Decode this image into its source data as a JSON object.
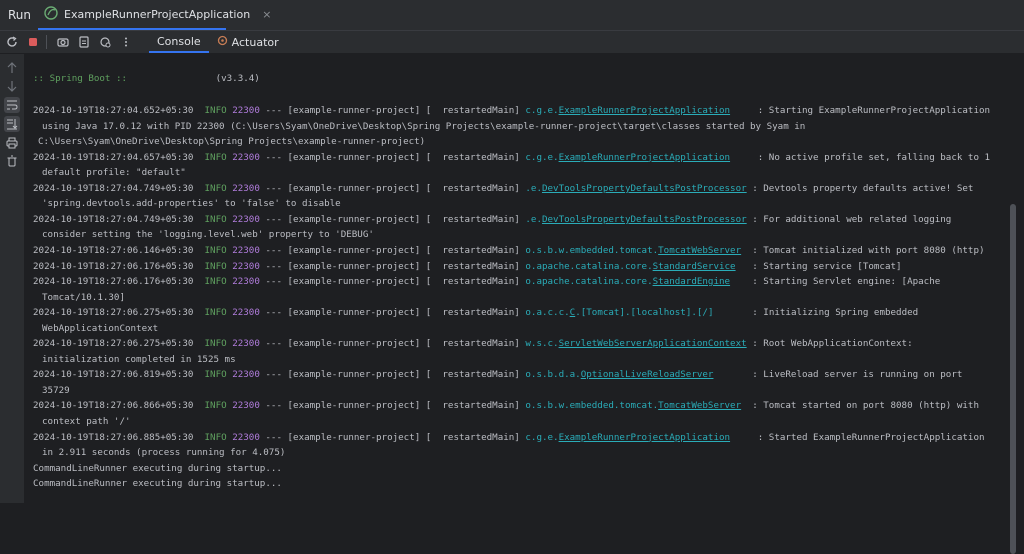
{
  "topbar": {
    "run_label": "Run",
    "tab_title": "ExampleRunnerProjectApplication",
    "tab_close": "×"
  },
  "toolbar": {
    "tabs": [
      {
        "label": "Console"
      },
      {
        "label": "Actuator"
      }
    ]
  },
  "console": {
    "boot_name": ":: Spring Boot ::",
    "boot_version": "(v3.3.4)",
    "logs": [
      {
        "ts": "2024-10-19T18:27:04.652+05:30",
        "level": "INFO",
        "pid": "22300",
        "mid": " --- [example-runner-project] [  restartedMain] ",
        "logger_prefix": "c.g.e.",
        "logger_link": "ExampleRunnerProjectApplication",
        "logger_suffix": "",
        "pad": "     ",
        "msg": ": Starting ExampleRunnerProjectApplication",
        "cont": [
          "using Java 17.0.12 with PID 22300 (C:\\Users\\Syam\\OneDrive\\Desktop\\Spring Projects\\example-runner-project\\target\\classes started by Syam in",
          "C:\\Users\\Syam\\OneDrive\\Desktop\\Spring Projects\\example-runner-project)"
        ]
      },
      {
        "ts": "2024-10-19T18:27:04.657+05:30",
        "level": "INFO",
        "pid": "22300",
        "mid": " --- [example-runner-project] [  restartedMain] ",
        "logger_prefix": "c.g.e.",
        "logger_link": "ExampleRunnerProjectApplication",
        "logger_suffix": "",
        "pad": "     ",
        "msg": ": No active profile set, falling back to 1",
        "cont": [
          "default profile: \"default\""
        ]
      },
      {
        "ts": "2024-10-19T18:27:04.749+05:30",
        "level": "INFO",
        "pid": "22300",
        "mid": " --- [example-runner-project] [  restartedMain] ",
        "logger_prefix": ".e.",
        "logger_link": "DevToolsPropertyDefaultsPostProcessor",
        "logger_suffix": "",
        "pad": " ",
        "msg": ": Devtools property defaults active! Set",
        "cont": [
          "'spring.devtools.add-properties' to 'false' to disable"
        ]
      },
      {
        "ts": "2024-10-19T18:27:04.749+05:30",
        "level": "INFO",
        "pid": "22300",
        "mid": " --- [example-runner-project] [  restartedMain] ",
        "logger_prefix": ".e.",
        "logger_link": "DevToolsPropertyDefaultsPostProcessor",
        "logger_suffix": "",
        "pad": " ",
        "msg": ": For additional web related logging",
        "cont": [
          "consider setting the 'logging.level.web' property to 'DEBUG'"
        ]
      },
      {
        "ts": "2024-10-19T18:27:06.146+05:30",
        "level": "INFO",
        "pid": "22300",
        "mid": " --- [example-runner-project] [  restartedMain] ",
        "logger_prefix": "o.s.b.w.embedded.tomcat.",
        "logger_link": "TomcatWebServer",
        "logger_suffix": "",
        "pad": "  ",
        "msg": ": Tomcat initialized with port 8080 (http)",
        "cont": []
      },
      {
        "ts": "2024-10-19T18:27:06.176+05:30",
        "level": "INFO",
        "pid": "22300",
        "mid": " --- [example-runner-project] [  restartedMain] ",
        "logger_prefix": "o.apache.catalina.core.",
        "logger_link": "StandardService",
        "logger_suffix": "",
        "pad": "   ",
        "msg": ": Starting service [Tomcat]",
        "cont": []
      },
      {
        "ts": "2024-10-19T18:27:06.176+05:30",
        "level": "INFO",
        "pid": "22300",
        "mid": " --- [example-runner-project] [  restartedMain] ",
        "logger_prefix": "o.apache.catalina.core.",
        "logger_link": "StandardEngine",
        "logger_suffix": "",
        "pad": "    ",
        "msg": ": Starting Servlet engine: [Apache",
        "cont": [
          "Tomcat/10.1.30]"
        ]
      },
      {
        "ts": "2024-10-19T18:27:06.275+05:30",
        "level": "INFO",
        "pid": "22300",
        "mid": " --- [example-runner-project] [  restartedMain] ",
        "logger_prefix": "o.a.c.c.",
        "logger_link": "C",
        "logger_suffix": ".[Tomcat].[localhost].[/]",
        "pad": "       ",
        "msg": ": Initializing Spring embedded",
        "cont": [
          "WebApplicationContext"
        ]
      },
      {
        "ts": "2024-10-19T18:27:06.275+05:30",
        "level": "INFO",
        "pid": "22300",
        "mid": " --- [example-runner-project] [  restartedMain] ",
        "logger_prefix": "w.s.c.",
        "logger_link": "ServletWebServerApplicationContext",
        "logger_suffix": "",
        "pad": " ",
        "msg": ": Root WebApplicationContext:",
        "cont": [
          "initialization completed in 1525 ms"
        ]
      },
      {
        "ts": "2024-10-19T18:27:06.819+05:30",
        "level": "INFO",
        "pid": "22300",
        "mid": " --- [example-runner-project] [  restartedMain] ",
        "logger_prefix": "o.s.b.d.a.",
        "logger_link": "OptionalLiveReloadServer",
        "logger_suffix": "",
        "pad": "       ",
        "msg": ": LiveReload server is running on port",
        "cont": [
          "35729"
        ]
      },
      {
        "ts": "2024-10-19T18:27:06.866+05:30",
        "level": "INFO",
        "pid": "22300",
        "mid": " --- [example-runner-project] [  restartedMain] ",
        "logger_prefix": "o.s.b.w.embedded.tomcat.",
        "logger_link": "TomcatWebServer",
        "logger_suffix": "",
        "pad": "  ",
        "msg": ": Tomcat started on port 8080 (http) with",
        "cont": [
          "context path '/'"
        ]
      },
      {
        "ts": "2024-10-19T18:27:06.885+05:30",
        "level": "INFO",
        "pid": "22300",
        "mid": " --- [example-runner-project] [  restartedMain] ",
        "logger_prefix": "c.g.e.",
        "logger_link": "ExampleRunnerProjectApplication",
        "logger_suffix": "",
        "pad": "     ",
        "msg": ": Started ExampleRunnerProjectApplication",
        "cont": [
          "in 2.911 seconds (process running for 4.075)"
        ]
      }
    ],
    "plain_lines": [
      "CommandLineRunner executing during startup...",
      "CommandLineRunner executing during startup..."
    ]
  },
  "colors": {
    "background": "#1e1f22",
    "panel": "#2b2d30",
    "info": "#5fa05f",
    "pid": "#b07cdb",
    "logger": "#2aacb8",
    "accent": "#3574f0"
  },
  "icons": [
    "spring-run-icon",
    "rerun-icon",
    "stop-icon",
    "screenshot-icon",
    "export-icon",
    "debug-icon",
    "more-icon",
    "actuator-icon",
    "up-arrow-icon",
    "down-arrow-icon",
    "soft-wrap-icon",
    "scroll-to-end-icon",
    "print-icon",
    "trash-icon"
  ]
}
